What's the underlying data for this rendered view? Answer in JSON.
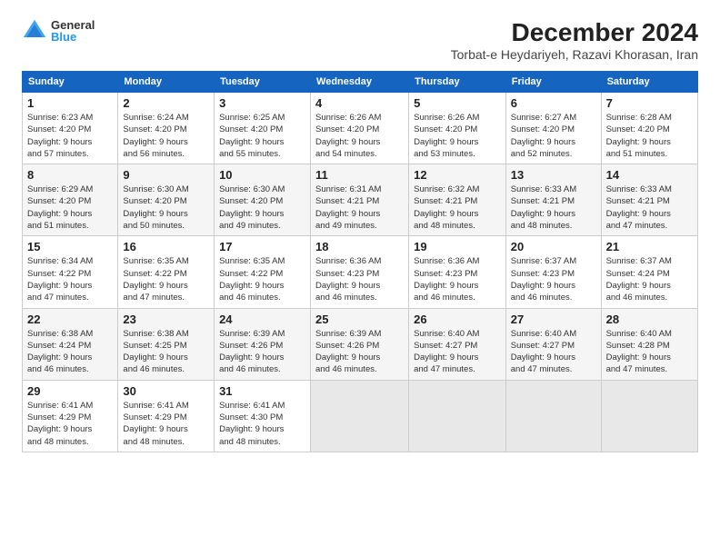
{
  "logo": {
    "general": "General",
    "blue": "Blue"
  },
  "header": {
    "title": "December 2024",
    "subtitle": "Torbat-e Heydariyeh, Razavi Khorasan, Iran"
  },
  "calendar": {
    "days_of_week": [
      "Sunday",
      "Monday",
      "Tuesday",
      "Wednesday",
      "Thursday",
      "Friday",
      "Saturday"
    ],
    "weeks": [
      [
        {
          "day": "",
          "info": ""
        },
        {
          "day": "2",
          "info": "Sunrise: 6:24 AM\nSunset: 4:20 PM\nDaylight: 9 hours\nand 56 minutes."
        },
        {
          "day": "3",
          "info": "Sunrise: 6:25 AM\nSunset: 4:20 PM\nDaylight: 9 hours\nand 55 minutes."
        },
        {
          "day": "4",
          "info": "Sunrise: 6:26 AM\nSunset: 4:20 PM\nDaylight: 9 hours\nand 54 minutes."
        },
        {
          "day": "5",
          "info": "Sunrise: 6:26 AM\nSunset: 4:20 PM\nDaylight: 9 hours\nand 53 minutes."
        },
        {
          "day": "6",
          "info": "Sunrise: 6:27 AM\nSunset: 4:20 PM\nDaylight: 9 hours\nand 52 minutes."
        },
        {
          "day": "7",
          "info": "Sunrise: 6:28 AM\nSunset: 4:20 PM\nDaylight: 9 hours\nand 51 minutes."
        }
      ],
      [
        {
          "day": "1",
          "info": "Sunrise: 6:23 AM\nSunset: 4:20 PM\nDaylight: 9 hours\nand 57 minutes."
        },
        {
          "day": "",
          "info": ""
        },
        {
          "day": "",
          "info": ""
        },
        {
          "day": "",
          "info": ""
        },
        {
          "day": "",
          "info": ""
        },
        {
          "day": "",
          "info": ""
        },
        {
          "day": "",
          "info": ""
        }
      ],
      [
        {
          "day": "8",
          "info": "Sunrise: 6:29 AM\nSunset: 4:20 PM\nDaylight: 9 hours\nand 51 minutes."
        },
        {
          "day": "9",
          "info": "Sunrise: 6:30 AM\nSunset: 4:20 PM\nDaylight: 9 hours\nand 50 minutes."
        },
        {
          "day": "10",
          "info": "Sunrise: 6:30 AM\nSunset: 4:20 PM\nDaylight: 9 hours\nand 49 minutes."
        },
        {
          "day": "11",
          "info": "Sunrise: 6:31 AM\nSunset: 4:21 PM\nDaylight: 9 hours\nand 49 minutes."
        },
        {
          "day": "12",
          "info": "Sunrise: 6:32 AM\nSunset: 4:21 PM\nDaylight: 9 hours\nand 48 minutes."
        },
        {
          "day": "13",
          "info": "Sunrise: 6:33 AM\nSunset: 4:21 PM\nDaylight: 9 hours\nand 48 minutes."
        },
        {
          "day": "14",
          "info": "Sunrise: 6:33 AM\nSunset: 4:21 PM\nDaylight: 9 hours\nand 47 minutes."
        }
      ],
      [
        {
          "day": "15",
          "info": "Sunrise: 6:34 AM\nSunset: 4:22 PM\nDaylight: 9 hours\nand 47 minutes."
        },
        {
          "day": "16",
          "info": "Sunrise: 6:35 AM\nSunset: 4:22 PM\nDaylight: 9 hours\nand 47 minutes."
        },
        {
          "day": "17",
          "info": "Sunrise: 6:35 AM\nSunset: 4:22 PM\nDaylight: 9 hours\nand 46 minutes."
        },
        {
          "day": "18",
          "info": "Sunrise: 6:36 AM\nSunset: 4:23 PM\nDaylight: 9 hours\nand 46 minutes."
        },
        {
          "day": "19",
          "info": "Sunrise: 6:36 AM\nSunset: 4:23 PM\nDaylight: 9 hours\nand 46 minutes."
        },
        {
          "day": "20",
          "info": "Sunrise: 6:37 AM\nSunset: 4:23 PM\nDaylight: 9 hours\nand 46 minutes."
        },
        {
          "day": "21",
          "info": "Sunrise: 6:37 AM\nSunset: 4:24 PM\nDaylight: 9 hours\nand 46 minutes."
        }
      ],
      [
        {
          "day": "22",
          "info": "Sunrise: 6:38 AM\nSunset: 4:24 PM\nDaylight: 9 hours\nand 46 minutes."
        },
        {
          "day": "23",
          "info": "Sunrise: 6:38 AM\nSunset: 4:25 PM\nDaylight: 9 hours\nand 46 minutes."
        },
        {
          "day": "24",
          "info": "Sunrise: 6:39 AM\nSunset: 4:26 PM\nDaylight: 9 hours\nand 46 minutes."
        },
        {
          "day": "25",
          "info": "Sunrise: 6:39 AM\nSunset: 4:26 PM\nDaylight: 9 hours\nand 46 minutes."
        },
        {
          "day": "26",
          "info": "Sunrise: 6:40 AM\nSunset: 4:27 PM\nDaylight: 9 hours\nand 47 minutes."
        },
        {
          "day": "27",
          "info": "Sunrise: 6:40 AM\nSunset: 4:27 PM\nDaylight: 9 hours\nand 47 minutes."
        },
        {
          "day": "28",
          "info": "Sunrise: 6:40 AM\nSunset: 4:28 PM\nDaylight: 9 hours\nand 47 minutes."
        }
      ],
      [
        {
          "day": "29",
          "info": "Sunrise: 6:41 AM\nSunset: 4:29 PM\nDaylight: 9 hours\nand 48 minutes."
        },
        {
          "day": "30",
          "info": "Sunrise: 6:41 AM\nSunset: 4:29 PM\nDaylight: 9 hours\nand 48 minutes."
        },
        {
          "day": "31",
          "info": "Sunrise: 6:41 AM\nSunset: 4:30 PM\nDaylight: 9 hours\nand 48 minutes."
        },
        {
          "day": "",
          "info": ""
        },
        {
          "day": "",
          "info": ""
        },
        {
          "day": "",
          "info": ""
        },
        {
          "day": "",
          "info": ""
        }
      ]
    ]
  }
}
